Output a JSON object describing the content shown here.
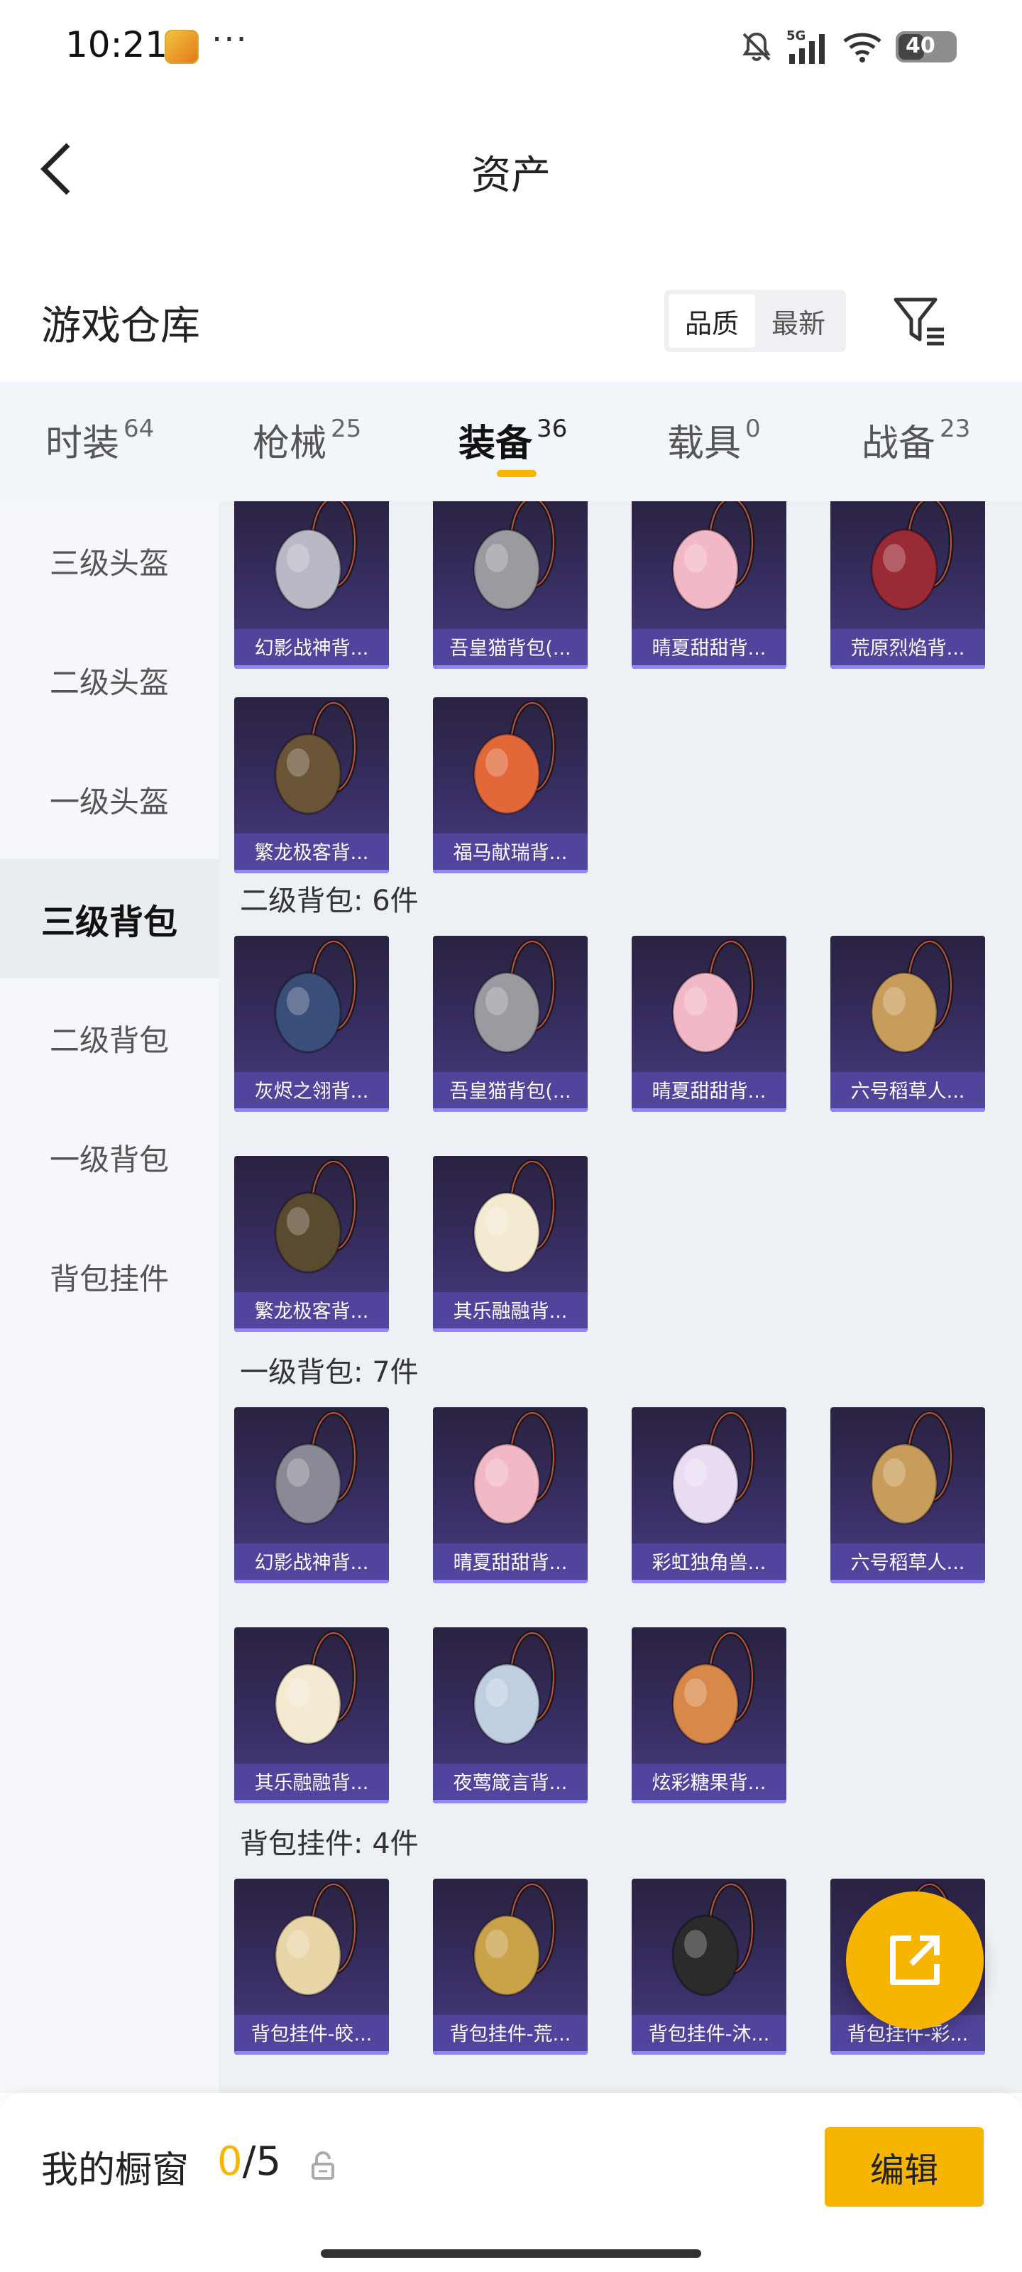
{
  "status_bar": {
    "time": "10:21",
    "dots": "···",
    "network": "5G",
    "battery": "40"
  },
  "nav": {
    "title": "资产",
    "back_icon": "chevron-left-icon"
  },
  "warehouse": {
    "title": "游戏仓库",
    "sort_options": [
      "品质",
      "最新"
    ],
    "selected_sort": "品质",
    "filter_icon": "filter-icon"
  },
  "tabs": [
    {
      "label": "时装",
      "count": "64",
      "active": false
    },
    {
      "label": "枪械",
      "count": "25",
      "active": false
    },
    {
      "label": "装备",
      "count": "36",
      "active": true
    },
    {
      "label": "载具",
      "count": "0",
      "active": false
    },
    {
      "label": "战备",
      "count": "23",
      "active": false
    }
  ],
  "sidebar": [
    {
      "label": "三级头盔",
      "active": false
    },
    {
      "label": "二级头盔",
      "active": false
    },
    {
      "label": "一级头盔",
      "active": false
    },
    {
      "label": "三级背包",
      "active": true
    },
    {
      "label": "二级背包",
      "active": false
    },
    {
      "label": "一级背包",
      "active": false
    },
    {
      "label": "背包挂件",
      "active": false
    }
  ],
  "sections": [
    {
      "title": "",
      "items": [
        {
          "name": "幻影战神背...",
          "color": "#b9b9c6"
        },
        {
          "name": "吾皇猫背包(...",
          "color": "#9a9aa0"
        },
        {
          "name": "晴夏甜甜背...",
          "color": "#f2b8c6"
        },
        {
          "name": "荒原烈焰背...",
          "color": "#9a2a34"
        },
        {
          "name": "繁龙极客背...",
          "color": "#6a5536"
        },
        {
          "name": "福马献瑞背...",
          "color": "#e2683a"
        }
      ]
    },
    {
      "title": "二级背包: 6件",
      "items": [
        {
          "name": "灰烬之翎背...",
          "color": "#3a4e7a"
        },
        {
          "name": "吾皇猫背包(...",
          "color": "#9a9aa0"
        },
        {
          "name": "晴夏甜甜背...",
          "color": "#f2b8c6"
        },
        {
          "name": "六号稻草人...",
          "color": "#c89c5a"
        },
        {
          "name": "繁龙极客背...",
          "color": "#5a4a30"
        },
        {
          "name": "其乐融融背...",
          "color": "#f4ead2"
        }
      ]
    },
    {
      "title": "一级背包: 7件",
      "items": [
        {
          "name": "幻影战神背...",
          "color": "#8a8a96"
        },
        {
          "name": "晴夏甜甜背...",
          "color": "#f2b8c6"
        },
        {
          "name": "彩虹独角兽...",
          "color": "#e9dcf2"
        },
        {
          "name": "六号稻草人...",
          "color": "#c89c5a"
        },
        {
          "name": "其乐融融背...",
          "color": "#f4ead2"
        },
        {
          "name": "夜莺箴言背...",
          "color": "#bfcfe0"
        },
        {
          "name": "炫彩糖果背...",
          "color": "#d8894a"
        }
      ]
    },
    {
      "title": "背包挂件: 4件",
      "items": [
        {
          "name": "背包挂件-皎...",
          "color": "#e8d6a8"
        },
        {
          "name": "背包挂件-荒...",
          "color": "#c9a24a"
        },
        {
          "name": "背包挂件-沐...",
          "color": "#2b2b2b"
        },
        {
          "name": "背包挂件-彩...",
          "color": "#f0c0d0"
        }
      ]
    }
  ],
  "fab_icon": "share-icon",
  "bottom_bar": {
    "label": "我的橱窗",
    "count_used": "0",
    "count_total": "/5",
    "edit_label": "编辑",
    "lock_icon": "lock-icon"
  },
  "colors": {
    "accent": "#f7b500",
    "card_bg": "#3a2f66",
    "card_label": "#5246a0"
  }
}
